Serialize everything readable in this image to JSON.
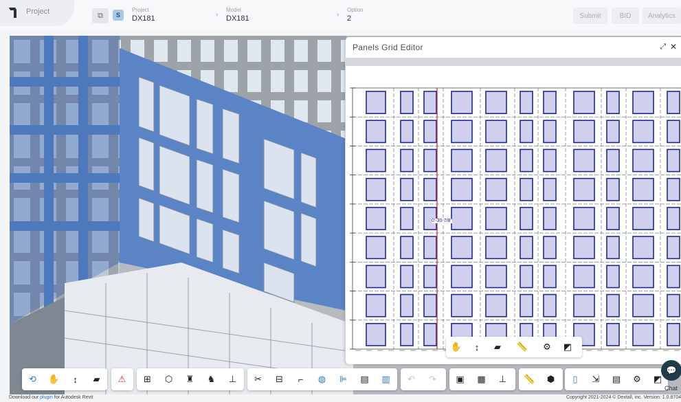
{
  "header": {
    "project_tab": "Project",
    "project": {
      "label": "Project",
      "value": "DX181"
    },
    "model": {
      "label": "Model",
      "value": "DX181"
    },
    "option": {
      "label": "Option",
      "value": "2"
    },
    "status_badge": "S",
    "buttons": {
      "submit": "Submit",
      "bid": "BID",
      "analytics": "Analytics"
    }
  },
  "editor": {
    "title": "Panels Grid Editor",
    "dimension_label": "0'-30-7/8\""
  },
  "chat": {
    "label": "Chat"
  },
  "footer": {
    "left_prefix": "Download our",
    "left_link": "plugin",
    "left_suffix": "for Autodesk Revit",
    "right": "Copyright 2021-2024 © Dextall, inc. Version: 1.0.8704"
  },
  "colors": {
    "facade_blue": "#4f79bd",
    "panel_fill": "#d0cfee",
    "panel_stroke": "#1e2a8a",
    "grid_red": "#d8232a",
    "accent_blue": "#2d7ad6"
  },
  "icons": {
    "viewport_tools": [
      "orbit-icon",
      "pan-hand-icon",
      "zoom-arrow-icon",
      "camera-icon"
    ],
    "warning": "warning-icon",
    "model_tools": [
      "grid-icon",
      "box-icon",
      "robot-icon",
      "robot-settings-icon",
      "hierarchy-icon"
    ],
    "edit_tools": [
      "scissors-icon",
      "split-icon",
      "paint-roller-icon",
      "globe-grid-icon",
      "align-icon",
      "sheets-icon",
      "panel-stack-icon"
    ],
    "history": [
      "undo-icon",
      "redo-icon"
    ],
    "view_tools": [
      "image-icon",
      "building-icon",
      "stamp-icon"
    ],
    "measure_tools": [
      "ruler-icon",
      "cube-settings-icon"
    ],
    "settings_tools": [
      "properties-icon",
      "export-icon",
      "report-icon",
      "gear-icon",
      "fullscreen-icon"
    ]
  }
}
